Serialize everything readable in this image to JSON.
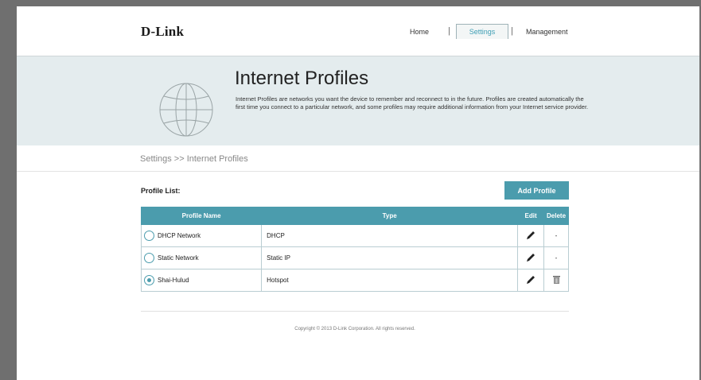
{
  "header": {
    "logo": "D-Link",
    "nav": {
      "home": "Home",
      "settings": "Settings",
      "management": "Management",
      "separator": "|"
    }
  },
  "hero": {
    "title": "Internet Profiles",
    "description": "Internet Profiles are networks you want the device to remember and reconnect to in the future. Profiles are created automatically the first time you connect to a particular network, and some profiles may require additional information from your Internet service provider."
  },
  "breadcrumb": "Settings >> Internet Profiles",
  "profile_list": {
    "label": "Profile List:",
    "add_button": "Add Profile",
    "columns": [
      "Profile Name",
      "Type",
      "Edit",
      "Delete"
    ],
    "rows": [
      {
        "name": "DHCP Network",
        "type": "DHCP",
        "selected": false,
        "delete": "-"
      },
      {
        "name": "Static Network",
        "type": "Static IP",
        "selected": false,
        "delete": "-"
      },
      {
        "name": "Shai-Hulud",
        "type": "Hotspot",
        "selected": true,
        "delete": "trash-icon"
      }
    ]
  },
  "footer": "Copyright © 2013 D-Link Corporation. All rights reserved.",
  "colors": {
    "accent": "#4b9cad",
    "hero_bg": "#e4ecee"
  }
}
